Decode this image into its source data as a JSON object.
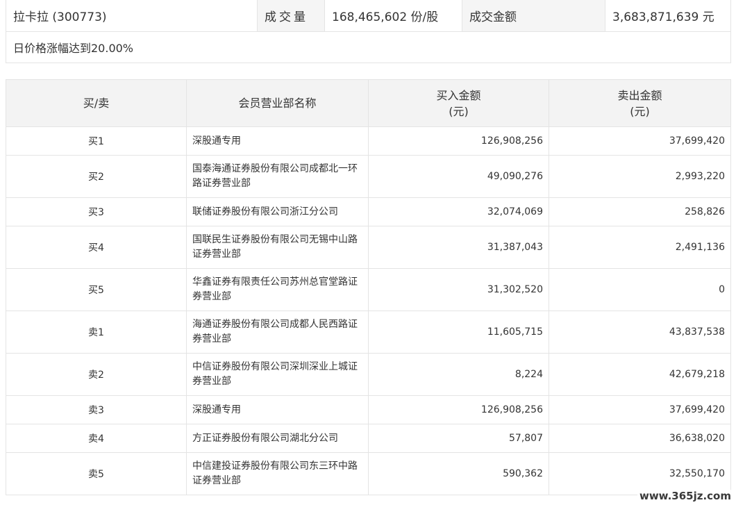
{
  "summary": {
    "stock": "拉卡拉 (300773)",
    "volume_label": "成交量",
    "volume_value": "168,465,602 份/股",
    "amount_label": "成交金额",
    "amount_value": "3,683,871,639 元",
    "reason": "日价格涨幅达到20.00%"
  },
  "table": {
    "headers": {
      "side": "买/卖",
      "broker": "会员营业部名称",
      "buy_line1": "买入金额",
      "buy_line2": "(元)",
      "sell_line1": "卖出金额",
      "sell_line2": "(元)"
    },
    "rows": [
      {
        "side": "买1",
        "broker_l1": "深股通专用",
        "broker_l2": "",
        "buy": "126,908,256",
        "sell": "37,699,420"
      },
      {
        "side": "买2",
        "broker_l1": "国泰海通证券股份有限公司成都北一环",
        "broker_l2": "路证券营业部",
        "buy": "49,090,276",
        "sell": "2,993,220"
      },
      {
        "side": "买3",
        "broker_l1": "联储证券股份有限公司浙江分公司",
        "broker_l2": "",
        "buy": "32,074,069",
        "sell": "258,826"
      },
      {
        "side": "买4",
        "broker_l1": "国联民生证券股份有限公司无锡中山路",
        "broker_l2": "证券营业部",
        "buy": "31,387,043",
        "sell": "2,491,136"
      },
      {
        "side": "买5",
        "broker_l1": "华鑫证券有限责任公司苏州总官堂路证",
        "broker_l2": "券营业部",
        "buy": "31,302,520",
        "sell": "0"
      },
      {
        "side": "卖1",
        "broker_l1": "海通证券股份有限公司成都人民西路证",
        "broker_l2": "券营业部",
        "buy": "11,605,715",
        "sell": "43,837,538"
      },
      {
        "side": "卖2",
        "broker_l1": "中信证券股份有限公司深圳深业上城证",
        "broker_l2": "券营业部",
        "buy": "8,224",
        "sell": "42,679,218"
      },
      {
        "side": "卖3",
        "broker_l1": "深股通专用",
        "broker_l2": "",
        "buy": "126,908,256",
        "sell": "37,699,420"
      },
      {
        "side": "卖4",
        "broker_l1": "方正证券股份有限公司湖北分公司",
        "broker_l2": "",
        "buy": "57,807",
        "sell": "36,638,020"
      },
      {
        "side": "卖5",
        "broker_l1": "中信建投证券股份有限公司东三环中路",
        "broker_l2": "证券营业部",
        "buy": "590,362",
        "sell": "32,550,170"
      }
    ]
  },
  "watermark": "www.365jz.com"
}
